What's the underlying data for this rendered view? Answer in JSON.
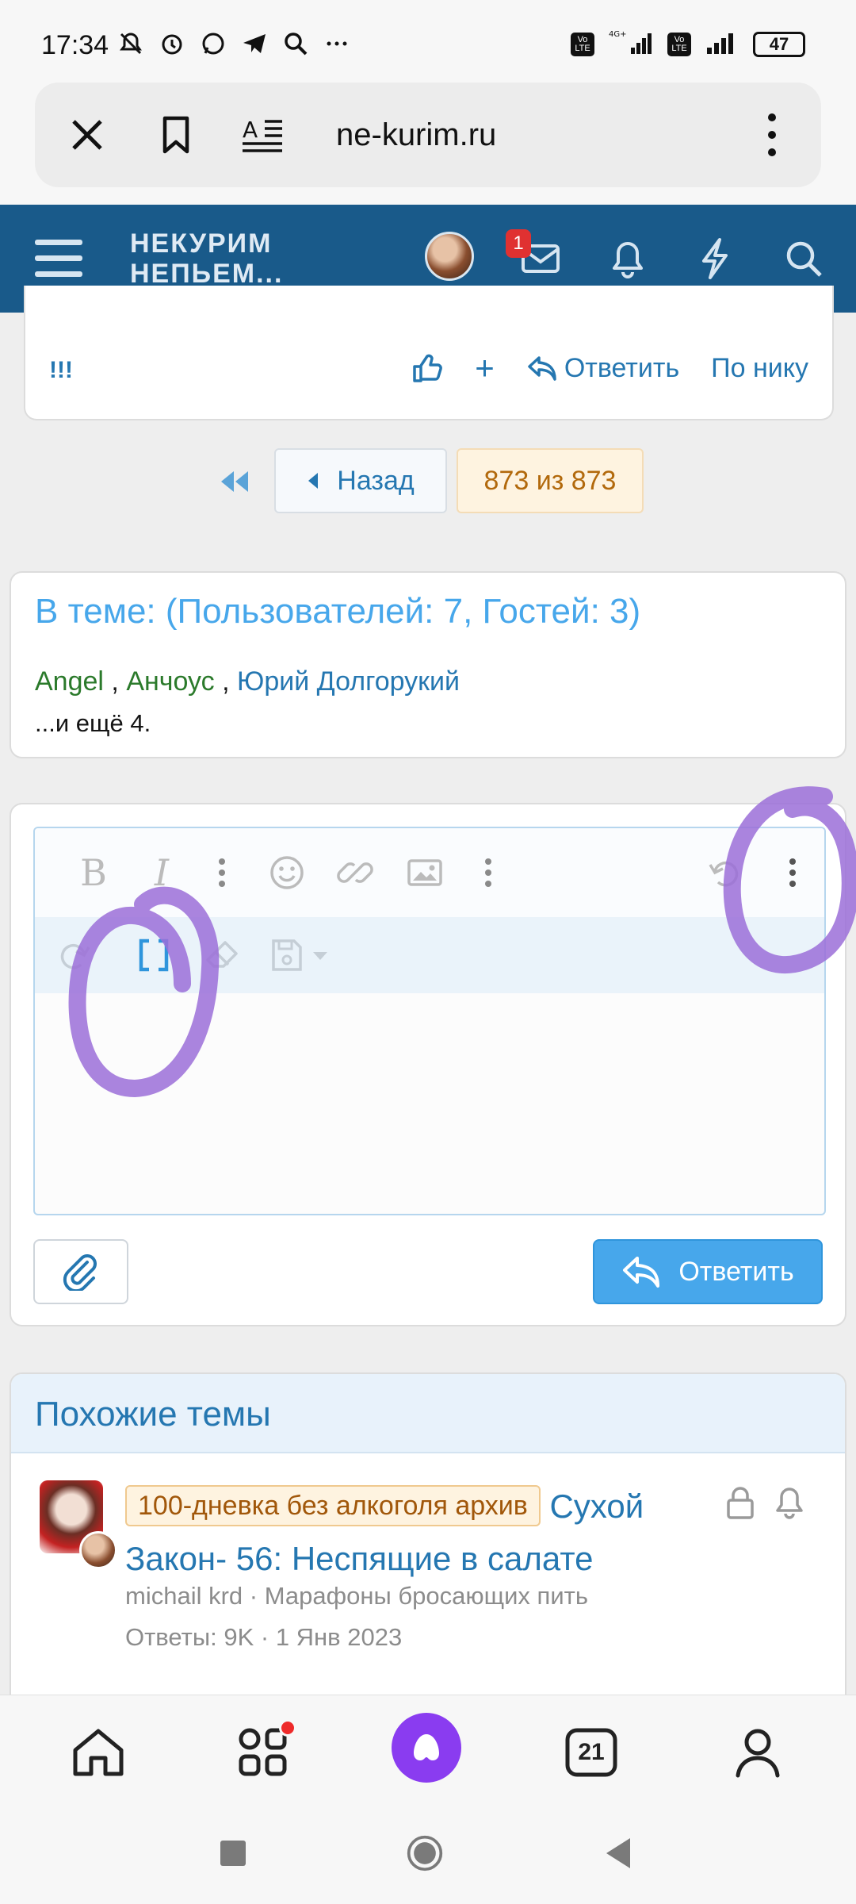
{
  "status_bar": {
    "time": "17:34",
    "network_label": "4G+",
    "volte_label": "Vo LTE",
    "battery": "47"
  },
  "browser": {
    "url": "ne-kurim.ru"
  },
  "site": {
    "logo_line1": "НЕКУРИМ",
    "logo_line2": "НЕПЬЕМ...",
    "notification_count": "1"
  },
  "post": {
    "text": "!!!",
    "plus_label": "+",
    "reply_label": "Ответить",
    "by_nick_label": "По нику"
  },
  "pagination": {
    "back_label": "Назад",
    "current_label": "873 из 873"
  },
  "online": {
    "title": "В теме: (Пользователей: 7, Гостей: 3)",
    "users": [
      {
        "name": "Angel"
      },
      {
        "name": "Анчоус"
      },
      {
        "name": "Юрий Долгорукий"
      }
    ],
    "separator": " , ",
    "more": "...и ещё 4."
  },
  "editor": {
    "bold_glyph": "B",
    "italic_glyph": "I",
    "reply_button": "Ответить"
  },
  "similar": {
    "title": "Похожие темы",
    "thread": {
      "prefix": "100-дневка без алкоголя архив",
      "title": "Сухой Закон- 56: Неспящие в салате",
      "author": "michail krd",
      "forum": "Марафоны бросающих пить",
      "meta_sep": " · ",
      "stats": "Ответы: 9K · 1 Янв 2023"
    }
  },
  "bottom_nav": {
    "tabs_count": "21"
  },
  "colors": {
    "header_bg": "#195a8a",
    "accent": "#47a7eb",
    "link": "#2577b1",
    "annotation": "#9b6fd8"
  }
}
